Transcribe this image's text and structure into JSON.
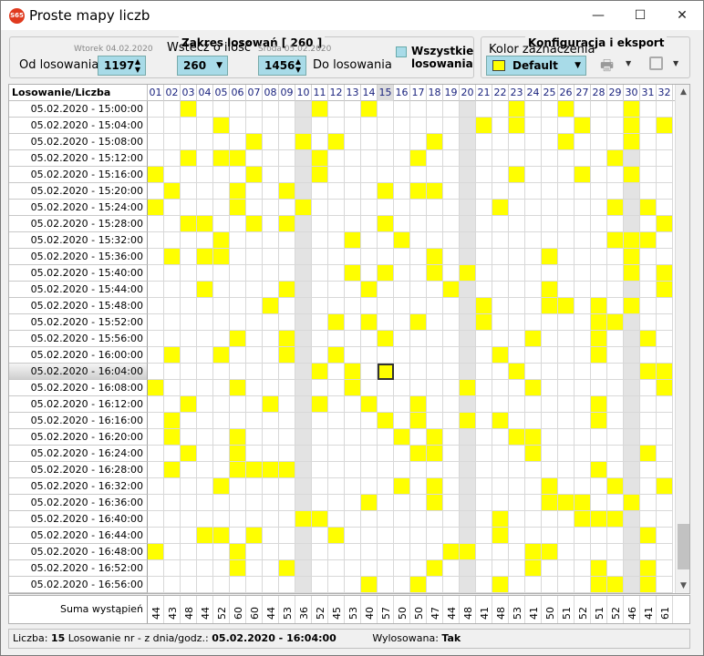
{
  "window": {
    "title": "Proste mapy liczb",
    "icon_text": "S65",
    "minimize": "—",
    "maximize": "☐",
    "close": "✕"
  },
  "range_group": {
    "title": "Zakres losowań  [ 260 ]",
    "from_date": "Wtorek 04.02.2020",
    "from_label": "Od losowania",
    "from_value": "1197",
    "back_label": "Wstecz o ilość",
    "back_value": "260",
    "to_date": "Środa 05.02.2020",
    "to_value": "1456",
    "to_label": "Do losowania",
    "all_label": "Wszystkie losowania"
  },
  "config_group": {
    "title": "Konfiguracja i eksport",
    "color_label": "Kolor zaznaczenia",
    "color_value": "Default",
    "color_swatch": "#ffff00"
  },
  "grid": {
    "corner_label": "Losowanie/Liczba",
    "columns": [
      "01",
      "02",
      "03",
      "04",
      "05",
      "06",
      "07",
      "08",
      "09",
      "10",
      "11",
      "12",
      "13",
      "14",
      "15",
      "16",
      "17",
      "18",
      "19",
      "20",
      "21",
      "22",
      "23",
      "24",
      "25",
      "26",
      "27",
      "28",
      "29",
      "30",
      "31",
      "32"
    ],
    "grey_columns": [
      10,
      20,
      30
    ],
    "selected_column": 15,
    "selected_row": 16,
    "rows": [
      {
        "label": "05.02.2020 - 15:00:00",
        "hits": [
          3,
          11,
          14,
          23,
          26,
          30
        ]
      },
      {
        "label": "05.02.2020 - 15:04:00",
        "hits": [
          5,
          21,
          23,
          27,
          30,
          32
        ]
      },
      {
        "label": "05.02.2020 - 15:08:00",
        "hits": [
          7,
          10,
          12,
          18,
          26,
          30
        ]
      },
      {
        "label": "05.02.2020 - 15:12:00",
        "hits": [
          3,
          5,
          6,
          11,
          17,
          29
        ]
      },
      {
        "label": "05.02.2020 - 15:16:00",
        "hits": [
          1,
          7,
          11,
          23,
          27,
          30
        ]
      },
      {
        "label": "05.02.2020 - 15:20:00",
        "hits": [
          2,
          6,
          9,
          15,
          17,
          18
        ]
      },
      {
        "label": "05.02.2020 - 15:24:00",
        "hits": [
          1,
          6,
          10,
          22,
          29,
          31
        ]
      },
      {
        "label": "05.02.2020 - 15:28:00",
        "hits": [
          3,
          4,
          7,
          9,
          15,
          32
        ]
      },
      {
        "label": "05.02.2020 - 15:32:00",
        "hits": [
          5,
          13,
          16,
          29,
          30,
          31
        ]
      },
      {
        "label": "05.02.2020 - 15:36:00",
        "hits": [
          2,
          4,
          5,
          18,
          25,
          30
        ]
      },
      {
        "label": "05.02.2020 - 15:40:00",
        "hits": [
          13,
          15,
          18,
          20,
          30,
          32
        ]
      },
      {
        "label": "05.02.2020 - 15:44:00",
        "hits": [
          4,
          9,
          14,
          19,
          25,
          32
        ]
      },
      {
        "label": "05.02.2020 - 15:48:00",
        "hits": [
          8,
          21,
          25,
          26,
          28,
          30
        ]
      },
      {
        "label": "05.02.2020 - 15:52:00",
        "hits": [
          12,
          14,
          17,
          21,
          28,
          29
        ]
      },
      {
        "label": "05.02.2020 - 15:56:00",
        "hits": [
          6,
          9,
          15,
          24,
          28,
          31
        ]
      },
      {
        "label": "05.02.2020 - 16:00:00",
        "hits": [
          2,
          5,
          9,
          12,
          22,
          28
        ]
      },
      {
        "label": "05.02.2020 - 16:04:00",
        "hits": [
          11,
          13,
          15,
          23,
          31,
          32
        ]
      },
      {
        "label": "05.02.2020 - 16:08:00",
        "hits": [
          1,
          6,
          13,
          20,
          24,
          32
        ]
      },
      {
        "label": "05.02.2020 - 16:12:00",
        "hits": [
          3,
          8,
          11,
          14,
          17,
          28
        ]
      },
      {
        "label": "05.02.2020 - 16:16:00",
        "hits": [
          2,
          15,
          17,
          20,
          22,
          28
        ]
      },
      {
        "label": "05.02.2020 - 16:20:00",
        "hits": [
          2,
          6,
          16,
          18,
          23,
          24
        ]
      },
      {
        "label": "05.02.2020 - 16:24:00",
        "hits": [
          3,
          6,
          17,
          18,
          24,
          31
        ]
      },
      {
        "label": "05.02.2020 - 16:28:00",
        "hits": [
          2,
          6,
          7,
          8,
          9,
          28
        ]
      },
      {
        "label": "05.02.2020 - 16:32:00",
        "hits": [
          5,
          16,
          18,
          25,
          29,
          32
        ]
      },
      {
        "label": "05.02.2020 - 16:36:00",
        "hits": [
          14,
          18,
          25,
          26,
          27,
          30
        ]
      },
      {
        "label": "05.02.2020 - 16:40:00",
        "hits": [
          10,
          11,
          22,
          27,
          28,
          29
        ]
      },
      {
        "label": "05.02.2020 - 16:44:00",
        "hits": [
          4,
          5,
          7,
          12,
          22,
          31
        ]
      },
      {
        "label": "05.02.2020 - 16:48:00",
        "hits": [
          1,
          6,
          19,
          20,
          24,
          25
        ]
      },
      {
        "label": "05.02.2020 - 16:52:00",
        "hits": [
          6,
          9,
          18,
          24,
          28,
          31
        ]
      },
      {
        "label": "05.02.2020 - 16:56:00",
        "hits": [
          14,
          17,
          22,
          28,
          29,
          31
        ]
      }
    ],
    "sum_label": "Suma wystąpień",
    "sums": [
      "44",
      "43",
      "48",
      "44",
      "52",
      "60",
      "60",
      "44",
      "53",
      "36",
      "52",
      "45",
      "53",
      "40",
      "57",
      "50",
      "50",
      "47",
      "44",
      "48",
      "41",
      "48",
      "53",
      "41",
      "50",
      "51",
      "52",
      "51",
      "52",
      "46",
      "41",
      "61"
    ]
  },
  "status": {
    "liczba_label": "Liczba:",
    "liczba_value": "15",
    "draw_label": "Losowanie nr - z dnia/godz.:",
    "draw_value": "05.02.2020 - 16:04:00",
    "drawn_label": "Wylosowana:",
    "drawn_value": "Tak"
  }
}
